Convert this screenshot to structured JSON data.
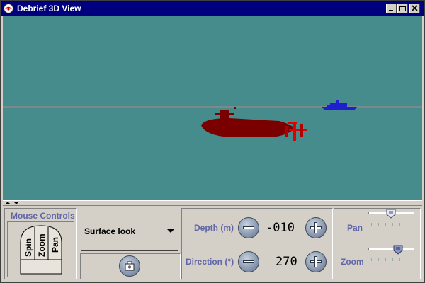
{
  "window": {
    "title": "Debrief 3D View"
  },
  "colors": {
    "title_bar": "#00007f",
    "scene_background": "#478c8c",
    "horizon": "#7a8a8a",
    "submarine": "#7a0000",
    "submarine_accent": "#e00000",
    "ship": "#1f1fd0",
    "label": "#6065a8"
  },
  "titlebar_buttons": [
    {
      "name": "minimize-button",
      "icon": "minimize-icon"
    },
    {
      "name": "maximize-button",
      "icon": "maximize-icon"
    },
    {
      "name": "close-button",
      "icon": "close-icon"
    }
  ],
  "mouse_controls": {
    "title": "Mouse Controls",
    "modes": [
      "Spin",
      "Zoom",
      "Pan"
    ]
  },
  "view_select": {
    "selected": "Surface look"
  },
  "snapshot_button": {
    "icon": "snapshot-icon"
  },
  "depth": {
    "label": "Depth (m)",
    "value": "-010"
  },
  "direction": {
    "label": "Direction (°)",
    "value": "270"
  },
  "sliders": {
    "pan": {
      "label": "Pan",
      "level_percent": 50
    },
    "zoom": {
      "label": "Zoom",
      "level_percent": 70
    }
  }
}
